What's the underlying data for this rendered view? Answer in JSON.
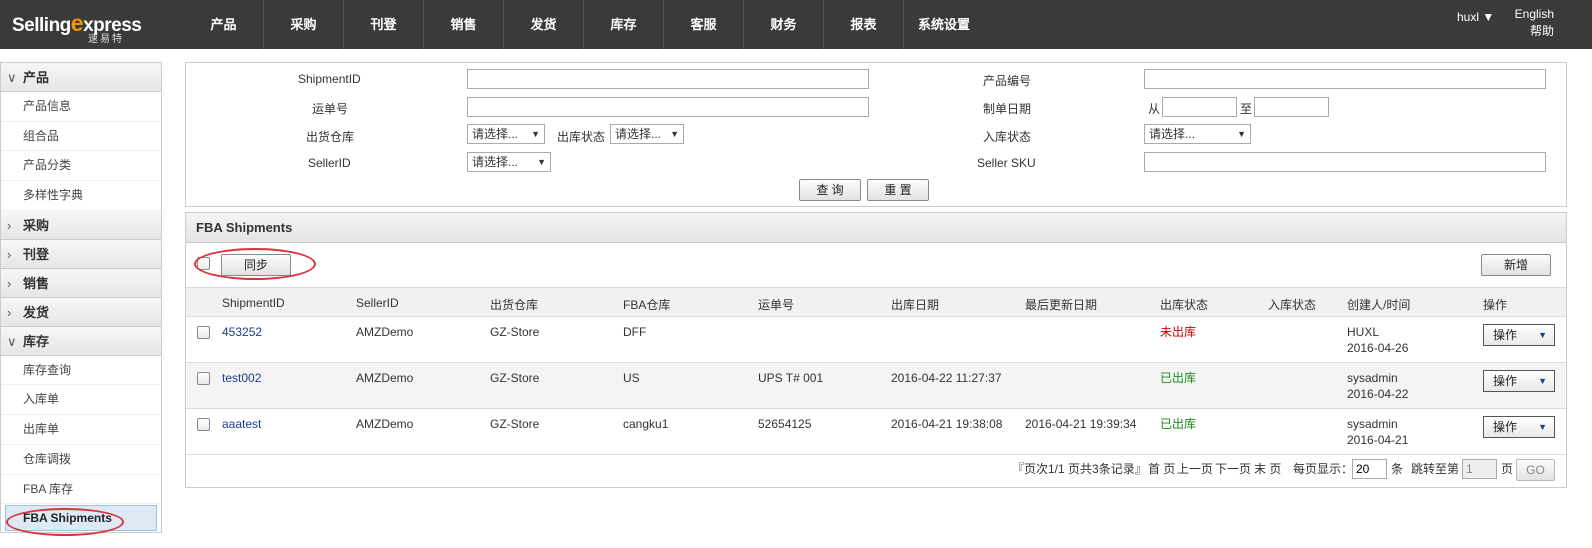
{
  "brand": {
    "name_part1": "Selling",
    "name_x": "e",
    "name_part2": "xpress",
    "sub": "速易特"
  },
  "nav": [
    "产品",
    "采购",
    "刊登",
    "销售",
    "发货",
    "库存",
    "客服",
    "财务",
    "报表",
    "系统设置"
  ],
  "user": {
    "name": "huxl ▼",
    "lang": "English",
    "help": "帮助"
  },
  "sidebar": {
    "product": {
      "label": "产品",
      "items": [
        "产品信息",
        "组合品",
        "产品分类",
        "多样性字典"
      ]
    },
    "purchase": "采购",
    "listing": "刊登",
    "sales": "销售",
    "shipping": "发货",
    "inventory": {
      "label": "库存",
      "items": [
        "库存查询",
        "入库单",
        "出库单",
        "仓库调拨",
        "FBA 库存",
        "FBA Shipments"
      ]
    }
  },
  "search": {
    "shipment_id_label": "ShipmentID",
    "tracking_label": "运单号",
    "warehouse_label": "出货仓库",
    "outbound_status_label": "出库状态",
    "seller_id_label": "SellerID",
    "product_code_label": "产品编号",
    "date_label": "制单日期",
    "date_from": "从",
    "date_to": "至",
    "inbound_status_label": "入库状态",
    "seller_sku_label": "Seller SKU",
    "select_placeholder": "请选择...",
    "query_button": "查 询",
    "reset_button": "重 置"
  },
  "panel": {
    "title": "FBA Shipments",
    "sync_button": "同步",
    "new_button": "新增",
    "columns": [
      "ShipmentID",
      "SellerID",
      "出货仓库",
      "FBA仓库",
      "运单号",
      "出库日期",
      "最后更新日期",
      "出库状态",
      "入库状态",
      "创建人/时间",
      "操作"
    ],
    "rows": [
      {
        "id": "453252",
        "seller": "AMZDemo",
        "warehouse": "GZ-Store",
        "fba": "DFF",
        "tracking": "",
        "out_date": "",
        "updated": "",
        "out_status": "未出库",
        "in_status": "",
        "creator": "HUXL",
        "created": "2016-04-26",
        "op": "操作"
      },
      {
        "id": "test002",
        "seller": "AMZDemo",
        "warehouse": "GZ-Store",
        "fba": "US",
        "tracking": "UPS T# 001",
        "out_date": "2016-04-22 11:27:37",
        "updated": "",
        "out_status": "已出库",
        "in_status": "",
        "creator": "sysadmin",
        "created": "2016-04-22",
        "op": "操作"
      },
      {
        "id": "aaatest",
        "seller": "AMZDemo",
        "warehouse": "GZ-Store",
        "fba": "cangku1",
        "tracking": "52654125",
        "out_date": "2016-04-21 19:38:08",
        "updated": "2016-04-21 19:39:34",
        "out_status": "已出库",
        "in_status": "",
        "creator": "sysadmin",
        "created": "2016-04-21",
        "op": "操作"
      }
    ],
    "pager": {
      "summary": "『页次1/1  页共3条记录』",
      "first": "首 页",
      "prev": "上一页",
      "next": "下一页",
      "last": "末 页",
      "per_page_label": "每页显示：",
      "per_page_value": "20",
      "per_page_unit": "条",
      "jump_label": "跳转至第",
      "jump_value": "1",
      "jump_unit": "页",
      "go": "GO"
    }
  },
  "colors": {
    "topbar": "#3a3a3a",
    "accent": "#f29400",
    "link": "#1a3d8f",
    "red_status": "#cc0000",
    "green_status": "#1a8a1a",
    "highlight_circle": "#d9343a"
  }
}
